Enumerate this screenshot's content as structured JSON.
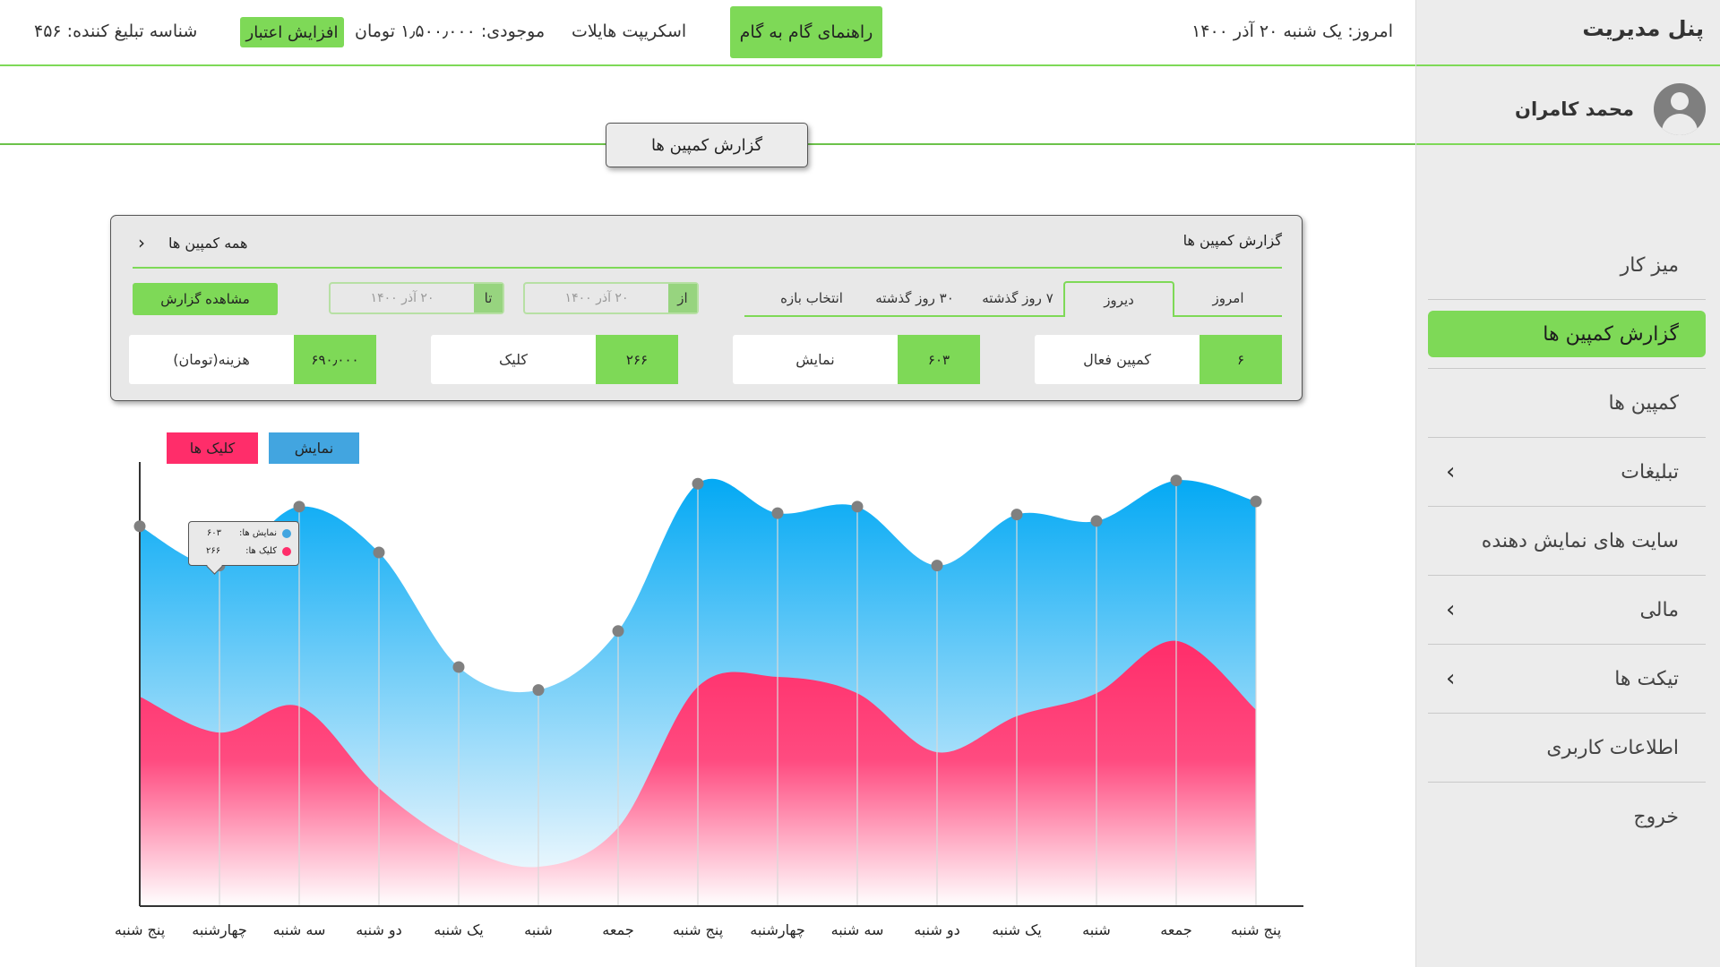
{
  "sidebar": {
    "title": "پنل مدیریت",
    "user_name": "محمد کامران",
    "items": [
      {
        "label": "میز کار",
        "active": false,
        "chevron": false
      },
      {
        "label": "گزارش کمپین ها",
        "active": true,
        "chevron": false
      },
      {
        "label": "کمپین ها",
        "active": false,
        "chevron": false
      },
      {
        "label": "تبلیغات",
        "active": false,
        "chevron": true
      },
      {
        "label": "سایت های نمایش دهنده",
        "active": false,
        "chevron": false
      },
      {
        "label": "مالی",
        "active": false,
        "chevron": true
      },
      {
        "label": "تیکت ها",
        "active": false,
        "chevron": true
      },
      {
        "label": "اطلاعات کاربری",
        "active": false,
        "chevron": false
      },
      {
        "label": "خروج",
        "active": false,
        "chevron": false
      }
    ]
  },
  "topbar": {
    "date": "امروز: یک شنبه ۲۰ آذر ۱۴۰۰",
    "guide": "راهنمای گام به گام",
    "script": "اسکریپت هایلات",
    "balance": "موجودی: ۱٫۵۰۰٫۰۰۰ تومان",
    "increase_credit": "افزایش اعتبار",
    "advertiser_id": "شناسه تبلیغ کننده: ۴۵۶"
  },
  "section_title": "گزارش کمپین ها",
  "report": {
    "title": "گزارش کمپین ها",
    "all_campaigns": "همه کمپین ها",
    "tabs": [
      "امروز",
      "دیروز",
      "۷ روز گذشته",
      "۳۰ روز گذشته",
      "انتخاب بازه"
    ],
    "selected_tab": "دیروز",
    "from_label": "از",
    "from_value": "۲۰ آذر ۱۴۰۰",
    "to_label": "تا",
    "to_value": "۲۰ آذر ۱۴۰۰",
    "view_button": "مشاهده گزارش",
    "stats": [
      {
        "label": "کمپین فعال",
        "value": "۶"
      },
      {
        "label": "نمایش",
        "value": "۶۰۳"
      },
      {
        "label": "کلیک",
        "value": "۲۶۶"
      },
      {
        "label": "هزینه(تومان)",
        "value": "۶۹۰٫۰۰۰"
      }
    ]
  },
  "legend": {
    "impressions": "نمایش",
    "clicks": "کلیک ها"
  },
  "tooltip": {
    "impressions_label": "نمایش ها:",
    "impressions_value": "۶۰۳",
    "clicks_label": "کلیک ها:",
    "clicks_value": "۲۶۶"
  },
  "colors": {
    "accent": "#7ed957",
    "impressions": "#03a9f4",
    "clicks": "#ff2d6a",
    "legend_impressions": "#42a5e0",
    "legend_clicks": "#ff2d6a"
  },
  "chart_data": {
    "type": "area",
    "x": [
      "پنج شنبه",
      "چهارشنبه",
      "سه شنبه",
      "دو شنبه",
      "یک شنبه",
      "شنبه",
      "جمعه",
      "پنج شنبه",
      "چهارشنبه",
      "سه شنبه",
      "دو شنبه",
      "یک شنبه",
      "شنبه",
      "جمعه",
      "پنج شنبه"
    ],
    "series": [
      {
        "name": "نمایش",
        "values": [
          580,
          520,
          610,
          540,
          365,
          330,
          420,
          645,
          600,
          610,
          520,
          598,
          588,
          650,
          618
        ]
      },
      {
        "name": "کلیک ها",
        "values": [
          320,
          265,
          305,
          180,
          95,
          60,
          120,
          335,
          350,
          325,
          235,
          290,
          325,
          405,
          300
        ]
      }
    ],
    "ylim": [
      0,
      700
    ],
    "grid": false
  }
}
